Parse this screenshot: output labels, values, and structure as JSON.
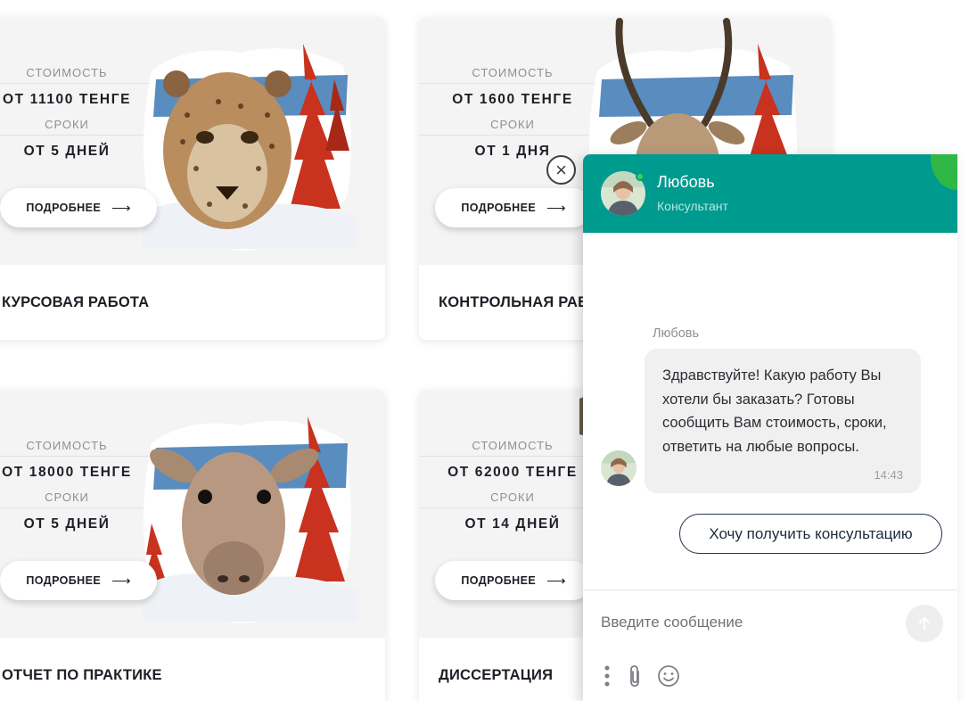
{
  "cards": [
    {
      "price_label": "СТОИМОСТЬ",
      "price": "ОТ 11100 ТЕНГЕ",
      "term_label": "СРОКИ",
      "term": "ОТ 5 ДНЕЙ",
      "button": "ПОДРОБНЕЕ",
      "title": "КУРСОВАЯ РАБОТА",
      "art_icon": "cheetah-forest-illustration"
    },
    {
      "price_label": "СТОИМОСТЬ",
      "price": "ОТ 1600 ТЕНГЕ",
      "term_label": "СРОКИ",
      "term": "ОТ 1 ДНЯ",
      "button": "ПОДРОБНЕЕ",
      "title": "КОНТРОЛЬНАЯ РАБ",
      "art_icon": "gazelle-forest-illustration"
    },
    {
      "price_label": "СТОИМОСТЬ",
      "price": "ОТ 18000 ТЕНГЕ",
      "term_label": "СРОКИ",
      "term": "ОТ 5 ДНЕЙ",
      "button": "ПОДРОБНЕЕ",
      "title": "ОТЧЕТ ПО ПРАКТИКЕ",
      "art_icon": "saiga-forest-illustration"
    },
    {
      "price_label": "СТОИМОСТЬ",
      "price": "ОТ 62000 ТЕНГЕ",
      "term_label": "СРОКИ",
      "term": "ОТ 14 ДНЕЙ",
      "button": "ПОДРОБНЕЕ",
      "title": "ДИССЕРТАЦИЯ",
      "art_icon": "animal-forest-illustration"
    }
  ],
  "chat": {
    "agent_name": "Любовь",
    "agent_role": "Консультант",
    "message_sender": "Любовь",
    "message_text": "Здравствуйте! Какую работу Вы хотели бы заказать? Готовы сообщить Вам стоимость, сроки, ответить на любые вопросы.",
    "message_time": "14:43",
    "quick_reply": "Хочу получить консультацию",
    "input_placeholder": "Введите сообщение",
    "icons": [
      "close-icon",
      "send-arrow-icon",
      "more-vertical-icon",
      "paperclip-icon",
      "emoji-icon"
    ]
  },
  "colors": {
    "chat_header": "#009b8f",
    "online": "#39d353",
    "accent_corner": "#2fb845",
    "art_red": "#c8321e",
    "art_sky": "#3c78b4"
  }
}
